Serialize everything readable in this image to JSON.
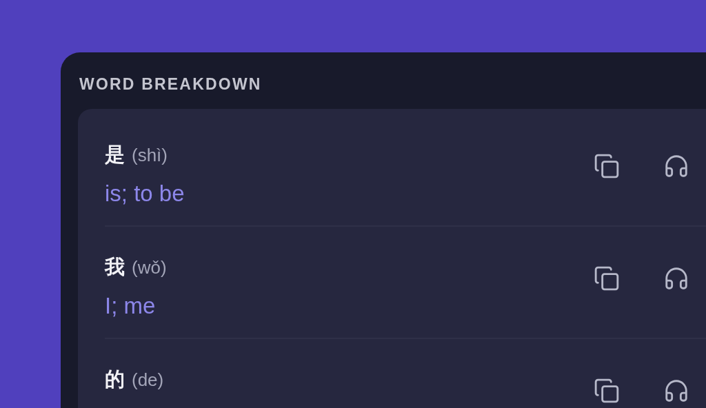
{
  "panel": {
    "title": "WORD BREAKDOWN"
  },
  "words": [
    {
      "hanzi": "是",
      "pinyin": "(shì)",
      "meaning": "is; to be"
    },
    {
      "hanzi": "我",
      "pinyin": "(wǒ)",
      "meaning": "I; me"
    },
    {
      "hanzi": "的",
      "pinyin": "(de)"
    }
  ]
}
